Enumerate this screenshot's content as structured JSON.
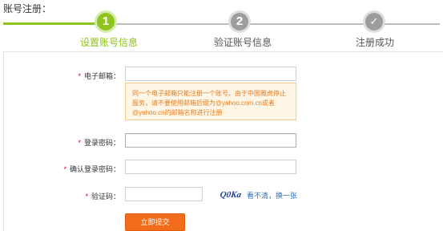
{
  "page": {
    "title": "账号注册："
  },
  "steps": [
    {
      "number": "1",
      "label": "设置账号信息",
      "state": "active"
    },
    {
      "number": "2",
      "label": "验证账号信息",
      "state": "inactive"
    },
    {
      "number": "✓",
      "label": "注册成功",
      "state": "inactive"
    }
  ],
  "colors": {
    "active": "#8fc31f",
    "inactive": "#9d9d9d",
    "required": "#e60012",
    "button": "#f36c1c",
    "tip_text": "#e67e22",
    "link": "#2b6fbf"
  },
  "form": {
    "required_mark": "*",
    "email": {
      "label": "电子邮箱：",
      "value": ""
    },
    "email_tip": "同一个电子邮箱只能注册一个账号。由于中国雅虎停止服务，请不要使用邮箱后缀为@yahoo.com.cn或者@yahoo.cn的邮箱名称进行注册",
    "password": {
      "label": "登录密码：",
      "value": ""
    },
    "confirm_password": {
      "label": "确认登录密码：",
      "value": ""
    },
    "captcha": {
      "label": "验证码：",
      "value": "",
      "image_text": "Q0Ka",
      "refresh_link": "看不清，换一张"
    },
    "submit_label": "立即提交"
  }
}
